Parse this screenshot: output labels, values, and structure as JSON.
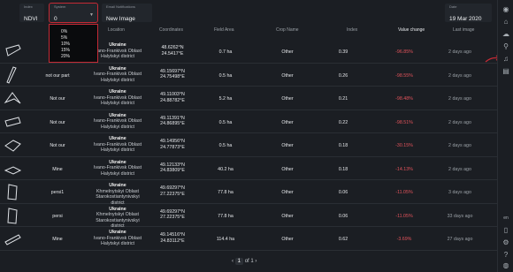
{
  "filters": {
    "index": {
      "label": "Index",
      "value": "NDVI"
    },
    "system": {
      "label": "System",
      "value": "0"
    },
    "email": {
      "label": "Email Notifications",
      "value": "New Image"
    },
    "date": {
      "label": "Date",
      "value": "19 Mar 2020"
    }
  },
  "dropdown_options": [
    "0%",
    "5%",
    "10%",
    "15%",
    "20%"
  ],
  "columns": [
    "Location",
    "Coordinates",
    "Field Area",
    "Crop Name",
    "Index",
    "Value change",
    "Last image"
  ],
  "rows": [
    {
      "name": "F...",
      "loc1": "Ukraine",
      "loc2": "Ivano-Frankivsk Oblast",
      "loc3": "Halytskyi district",
      "coord1": "48.6262°N",
      "coord2": "24.5417°E",
      "area": "0.7 ha",
      "crop": "Other",
      "index": "0.39",
      "change": "-96.85%",
      "last": "2 days ago"
    },
    {
      "name": "not our part",
      "loc1": "Ukraine",
      "loc2": "Ivano-Frankivsk Oblast",
      "loc3": "Halytskyi district",
      "coord1": "49.15697°N",
      "coord2": "24.75498°E",
      "area": "0.5 ha",
      "crop": "Other",
      "index": "0.26",
      "change": "-98.55%",
      "last": "2 days ago"
    },
    {
      "name": "Not our",
      "loc1": "Ukraine",
      "loc2": "Ivano-Frankivsk Oblast",
      "loc3": "Halytskyi district",
      "coord1": "49.11003°N",
      "coord2": "24.88782°E",
      "area": "5.2 ha",
      "crop": "Other",
      "index": "0.21",
      "change": "-98.48%",
      "last": "2 days ago"
    },
    {
      "name": "Not our",
      "loc1": "Ukraine",
      "loc2": "Ivano-Frankivsk Oblast",
      "loc3": "Halytskyi district",
      "coord1": "49.11391°N",
      "coord2": "24.86895°E",
      "area": "0.5 ha",
      "crop": "Other",
      "index": "0.22",
      "change": "-98.51%",
      "last": "2 days ago"
    },
    {
      "name": "Not our",
      "loc1": "Ukraine",
      "loc2": "Ivano-Frankivsk Oblast",
      "loc3": "Halytskyi district",
      "coord1": "49.14956°N",
      "coord2": "24.77873°E",
      "area": "0.5 ha",
      "crop": "Other",
      "index": "0.18",
      "change": "-30.15%",
      "last": "2 days ago"
    },
    {
      "name": "Mine",
      "loc1": "Ukraine",
      "loc2": "Ivano-Frankivsk Oblast",
      "loc3": "Halytskyi district",
      "coord1": "49.12133°N",
      "coord2": "24.83809°E",
      "area": "40.2 ha",
      "crop": "Other",
      "index": "0.18",
      "change": "-14.13%",
      "last": "2 days ago"
    },
    {
      "name": "persi1",
      "loc1": "Ukraine",
      "loc2": "Khmelnytskyi Oblast",
      "loc3": "Starokostiantynivskyi district",
      "coord1": "49.69297°N",
      "coord2": "27.22375°E",
      "area": "77.8 ha",
      "crop": "Other",
      "index": "0.06",
      "change": "-11.05%",
      "last": "3 days ago"
    },
    {
      "name": "persi",
      "loc1": "Ukraine",
      "loc2": "Khmelnytskyi Oblast",
      "loc3": "Starokostiantynivskyi district",
      "coord1": "49.69297°N",
      "coord2": "27.22375°E",
      "area": "77.8 ha",
      "crop": "Other",
      "index": "0.06",
      "change": "-11.05%",
      "last": "33 days ago"
    },
    {
      "name": "Mine",
      "loc1": "Ukraine",
      "loc2": "Ivano-Frankivsk Oblast",
      "loc3": "Halytskyi district",
      "coord1": "49.14516°N",
      "coord2": "24.83112°E",
      "area": "114.4 ha",
      "crop": "Other",
      "index": "0.62",
      "change": "-3.69%",
      "last": "27 days ago"
    }
  ],
  "pager": {
    "prev": "‹",
    "current": "1",
    "of": "of",
    "total": "1",
    "next": "›"
  },
  "colors": {
    "negative": "#e2535b",
    "highlight": "#c42a35"
  }
}
